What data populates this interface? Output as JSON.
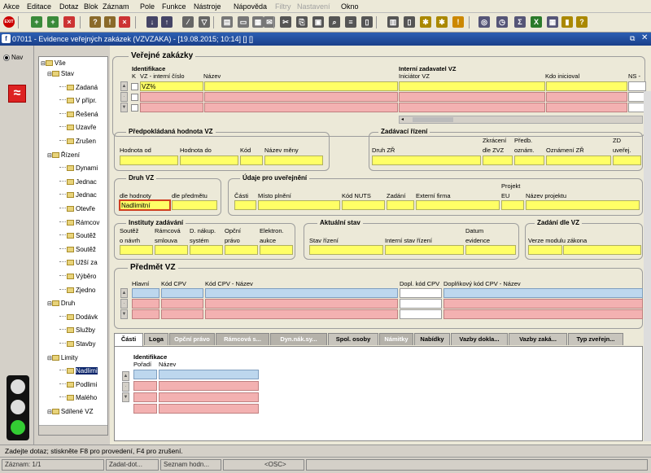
{
  "menu": [
    "Akce",
    "Editace",
    "Dotaz",
    "Blok",
    "Záznam",
    "Pole",
    "Funkce",
    "Nástroje",
    "Nápověda",
    "Filtry",
    "Nastavení",
    "Okno"
  ],
  "toolbar": {
    "exit_label": "EXIT"
  },
  "window": {
    "title": "07011 - Evidence veřejných zakázek (VZVZAKA) - [19.08.2015; 10:14] [] []"
  },
  "nav": {
    "label": "Nav"
  },
  "tree": {
    "root": "Vše",
    "nodes": [
      {
        "label": "Stav",
        "level": 1
      },
      {
        "label": "Zadaná",
        "level": 2
      },
      {
        "label": "V přípr.",
        "level": 2
      },
      {
        "label": "Řešená",
        "level": 2
      },
      {
        "label": "Uzavře",
        "level": 2
      },
      {
        "label": "Zrušen",
        "level": 2
      },
      {
        "label": "Řízení",
        "level": 1
      },
      {
        "label": "Dynami",
        "level": 2
      },
      {
        "label": "Jednac",
        "level": 2
      },
      {
        "label": "Jednac",
        "level": 2
      },
      {
        "label": "Otevře",
        "level": 2
      },
      {
        "label": "Rámcov",
        "level": 2
      },
      {
        "label": "Soutěž",
        "level": 2
      },
      {
        "label": "Soutěž",
        "level": 2
      },
      {
        "label": "Užší za",
        "level": 2
      },
      {
        "label": "Výběro",
        "level": 2
      },
      {
        "label": "Zjedno",
        "level": 2
      },
      {
        "label": "Druh",
        "level": 1
      },
      {
        "label": "Dodávk",
        "level": 2
      },
      {
        "label": "Služby",
        "level": 2
      },
      {
        "label": "Stavby",
        "level": 2
      },
      {
        "label": "Limity",
        "level": 1
      },
      {
        "label": "Nadlimi",
        "level": 2,
        "selected": true
      },
      {
        "label": "Podlimi",
        "level": 2
      },
      {
        "label": "Malého",
        "level": 2
      },
      {
        "label": "Sdílené VZ",
        "level": 1
      }
    ]
  },
  "form": {
    "title": "Veřejné zakázky",
    "ident_group": "Identifikace",
    "col_k": "K",
    "col_vz": "VZ - interní číslo",
    "col_nazev": "Název",
    "interni_group": "Interní zadavatel VZ",
    "col_iniciator": "Iniciátor VZ",
    "col_kdo": "Kdo inicioval",
    "col_ns": "NS -",
    "row1_vz": "VZ%",
    "hodnota": {
      "title": "Předpokládaná hodnota VZ",
      "od": "Hodnota od",
      "do": "Hodnota do",
      "kod": "Kód",
      "mena": "Název měny"
    },
    "zadavaci": {
      "title": "Zadávací řízení",
      "druh": "Druh ZŘ",
      "zkraceni": "Zkrácení",
      "dle_zvz": "dle ZVZ",
      "predb": "Předb.",
      "ozn": "oznám.",
      "oznameni": "Oznámení ZŘ",
      "zd": "ZD",
      "uverej": "uveřej."
    },
    "druh": {
      "title": "Druh VZ",
      "hodnoty": "dle hodnoty",
      "predmetu": "dle předmětu",
      "value": "Nadlimitní"
    },
    "udaje": {
      "title": "Údaje pro uveřejnění",
      "casti": "Části",
      "misto": "Místo plnění",
      "nuts": "Kód NUTS",
      "zadani": "Zadání",
      "firma": "Externí firma",
      "projekt": "Projekt",
      "eu": "EU",
      "nazev_proj": "Název projektu"
    },
    "instituty": {
      "title": "Instituty zadávání",
      "soutez1": "Soutěž",
      "soutez2": "o návrh",
      "ramc1": "Rámcová",
      "ramc2": "smlouva",
      "dn1": "D. nákup.",
      "dn2": "systém",
      "opc1": "Opční",
      "opc2": "právo",
      "el1": "Elektron.",
      "el2": "aukce"
    },
    "aktualni": {
      "title": "Aktuální stav",
      "stav": "Stav řízení",
      "interni": "Interní stav řízení",
      "datum1": "Datum",
      "datum2": "evidence"
    },
    "zadani_vz": {
      "title": "Zadání dle VZ",
      "verze": "Verze modulu zákona"
    },
    "predmet": {
      "title": "Předmět VZ",
      "hlavni": "Hlavní",
      "kod_cpv": "Kód CPV",
      "kod_nazev": "Kód CPV - Název",
      "dopl": "Dopl. kód CPV",
      "dopl_nazev": "Doplňkový kód CPV - Název"
    }
  },
  "tabs": [
    {
      "label": "Části",
      "state": "selected"
    },
    {
      "label": "Loga",
      "state": "normal"
    },
    {
      "label": "Opční právo",
      "state": "disabled"
    },
    {
      "label": "Rámcová s...",
      "state": "disabled"
    },
    {
      "label": "Dyn.nák.sy...",
      "state": "disabled"
    },
    {
      "label": "Spol. osoby",
      "state": "normal"
    },
    {
      "label": "Námitky",
      "state": "disabled"
    },
    {
      "label": "Nabídky",
      "state": "normal"
    },
    {
      "label": "Vazby dokla...",
      "state": "normal"
    },
    {
      "label": "Vazby zaká...",
      "state": "normal"
    },
    {
      "label": "Typ zveřejn...",
      "state": "normal"
    }
  ],
  "casti": {
    "group": "Identifikace",
    "poradi": "Pořadí",
    "nazev": "Název"
  },
  "status": {
    "message": "Zadejte dotaz; stiskněte F8 pro provedení, F4 pro zrušení.",
    "zaznam": "Záznam: 1/1",
    "seg2": "Zadat-dot...",
    "seg3": "Seznam hodn...",
    "seg4": "<OSC>"
  },
  "colors": {
    "yellow": "#ffff66",
    "pink": "#f3b1b1",
    "blue": "#bdd7ee",
    "title": "#1a3f8a"
  }
}
